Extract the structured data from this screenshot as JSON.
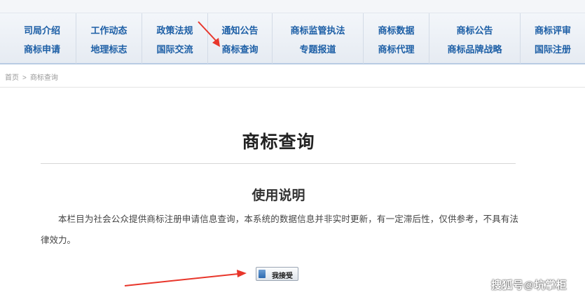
{
  "nav": {
    "columns": [
      {
        "top": "司局介绍",
        "bottom": "商标申请"
      },
      {
        "top": "工作动态",
        "bottom": "地理标志"
      },
      {
        "top": "政策法规",
        "bottom": "国际交流"
      },
      {
        "top": "通知公告",
        "bottom": "商标查询"
      },
      {
        "top": "商标监管执法",
        "bottom": "专题报道"
      },
      {
        "top": "商标数据",
        "bottom": "商标代理"
      },
      {
        "top": "商标公告",
        "bottom": "商标品牌战略"
      },
      {
        "top": "商标评审",
        "bottom": "国际注册"
      }
    ]
  },
  "breadcrumb": {
    "home": "首页",
    "separator": ">",
    "current": "商标查询"
  },
  "main": {
    "title": "商标查询",
    "usage_heading": "使用说明",
    "notice": "本栏目为社会公众提供商标注册申请信息查询，本系统的数据信息并非实时更新，有一定滞后性，仅供参考，不具有法律效力。",
    "accept_button": "我接受"
  },
  "annotations": {
    "arrow_color": "#e8362b"
  },
  "watermark": "搜狐号@坑掌柜",
  "colors": {
    "nav_text": "#1d5fa6",
    "nav_border": "#b8cbe3"
  }
}
